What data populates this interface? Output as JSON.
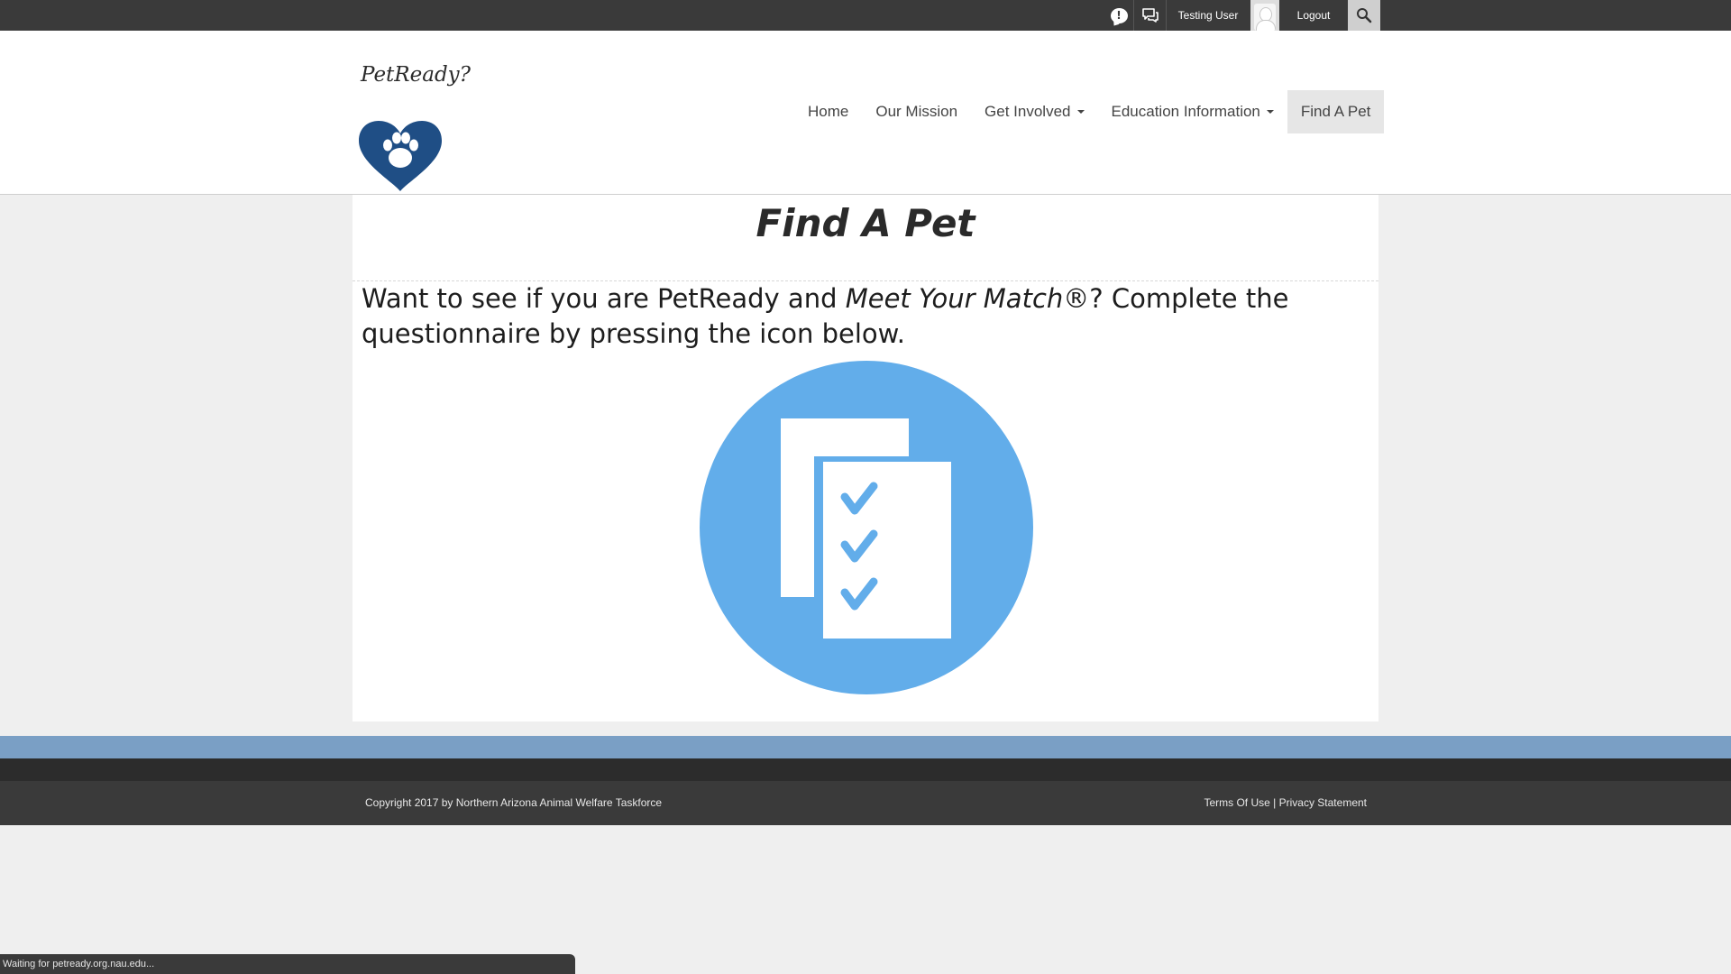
{
  "topbar": {
    "notification_icon": "exclamation-bubble-icon",
    "notification_glyph": "!",
    "messages_icon": "chat-bubbles-icon",
    "username": "Testing User",
    "avatar_icon": "user-avatar-icon",
    "logout_label": "Logout",
    "search_icon": "magnifier-icon"
  },
  "header": {
    "logo_text": "PetReady?",
    "logo_icon": "heart-paw-icon",
    "nav": [
      {
        "label": "Home",
        "has_dropdown": false,
        "active": false
      },
      {
        "label": "Our Mission",
        "has_dropdown": false,
        "active": false
      },
      {
        "label": "Get Involved",
        "has_dropdown": true,
        "active": false
      },
      {
        "label": "Education Information",
        "has_dropdown": true,
        "active": false
      },
      {
        "label": "Find A Pet",
        "has_dropdown": false,
        "active": true
      }
    ]
  },
  "main": {
    "title": "Find A Pet",
    "intro_part1": "Want to see if you are PetReady and ",
    "intro_italic": "Meet Your Match®",
    "intro_part2": "? Complete the questionnaire by pressing the icon below.",
    "questionnaire_icon": "checklist-icon"
  },
  "footer": {
    "copyright": "Copyright 2017 by Northern Arizona Animal Welfare Taskforce",
    "terms_label": "Terms Of Use",
    "separator": "|",
    "privacy_label": "Privacy Statement"
  },
  "status": {
    "text": "Waiting for petready.org.nau.edu..."
  },
  "colors": {
    "topbar": "#3a3a3a",
    "brand_blue": "#1f4e85",
    "icon_blue": "#62adea",
    "footer_band": "#7a9fc5",
    "footer": "#3a3a3a"
  }
}
